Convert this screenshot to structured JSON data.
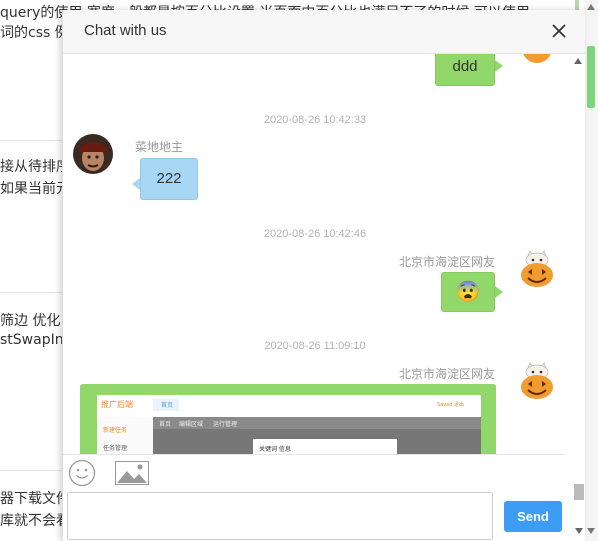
{
  "background": {
    "lines": [
      {
        "text": "query的使用 宽度一般都是按百分比设置 当页面中百分比也满足不了的时候 可以使用"
      },
      {
        "text": "词的css 例"
      },
      {
        "text": "接从待排序招"
      },
      {
        "text": "如果当前元"
      },
      {
        "text": "筛边 优化："
      },
      {
        "text": "stSwapIn"
      },
      {
        "text": "器下载文件"
      },
      {
        "text": "库就不会看"
      }
    ]
  },
  "chat": {
    "title": "Chat with us",
    "messages": [
      {
        "type": "text",
        "side": "right",
        "text": "ddd"
      },
      {
        "type": "timestamp",
        "text": "2020-08-26 10:42:33"
      },
      {
        "type": "text",
        "side": "left",
        "user": "菜地地主",
        "text": "222",
        "avatar": "pirate-avatar"
      },
      {
        "type": "timestamp",
        "text": "2020-08-26 10:42:46"
      },
      {
        "type": "emoji",
        "side": "right",
        "user": "北京市海淀区网友",
        "emoji": "😨",
        "avatar": "pumpkin-cat-avatar"
      },
      {
        "type": "timestamp",
        "text": "2020-08-26 11:09:10"
      },
      {
        "type": "image",
        "side": "right",
        "user": "北京市海淀区网友",
        "avatar": "pumpkin-cat-avatar",
        "screenshot": {
          "brand": "推广后端",
          "tabs": [
            "首页",
            "编辑区域",
            "运行管理"
          ],
          "side_items": [
            "新建任务",
            "任务管理"
          ],
          "dialog_title": "关键词 信息",
          "top_links": "Saved 退出"
        }
      }
    ],
    "toolbar": {
      "emoji_icon": "smiley-icon",
      "image_icon": "image-icon"
    },
    "input": {
      "placeholder": "",
      "value": ""
    },
    "send_label": "Send"
  },
  "colors": {
    "accent": "#3d9cf4",
    "green_bubble": "#91d76a",
    "blue_bubble": "#a7d7f5"
  }
}
